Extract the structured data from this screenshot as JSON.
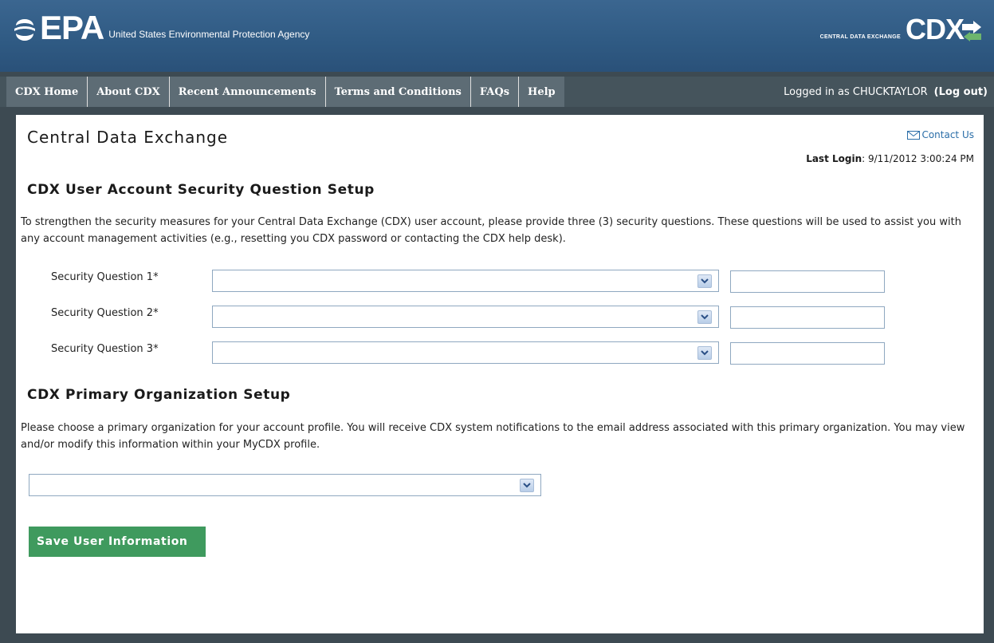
{
  "header": {
    "epa_logo_text": "EPA",
    "agency_name": "United States Environmental Protection Agency",
    "cdx_logo_subtext": "CENTRAL DATA EXCHANGE",
    "cdx_logo_text": "CDX"
  },
  "nav": {
    "items": [
      {
        "label": "CDX Home"
      },
      {
        "label": "About CDX"
      },
      {
        "label": "Recent Announcements"
      },
      {
        "label": "Terms and Conditions"
      },
      {
        "label": "FAQs"
      },
      {
        "label": "Help"
      }
    ],
    "logged_in_text": "Logged in as CHUCKTAYLOR",
    "logout_label": "(Log out)"
  },
  "main": {
    "title": "Central Data Exchange",
    "contact_label": "Contact Us",
    "last_login_label": "Last Login",
    "last_login_value": ": 9/11/2012 3:00:24 PM",
    "security": {
      "title": "CDX User Account Security Question Setup",
      "description": "To strengthen the security measures for your Central Data Exchange (CDX) user account, please provide three (3) security questions. These questions will be used to assist you with any account management activities (e.g., resetting you CDX password or contacting the CDX help desk).",
      "questions": [
        {
          "label": "Security Question 1*",
          "selected": "",
          "answer": ""
        },
        {
          "label": "Security Question 2*",
          "selected": "",
          "answer": ""
        },
        {
          "label": "Security Question 3*",
          "selected": "",
          "answer": ""
        }
      ]
    },
    "organization": {
      "title": "CDX Primary Organization Setup",
      "description": "Please choose a primary organization for your account profile. You will receive CDX system notifications to the email address associated with this primary organization. You may view and/or modify this information within your MyCDX profile.",
      "selected": ""
    },
    "save_label": "Save User Information"
  },
  "colors": {
    "header_blue": "#2f5a83",
    "nav_gray": "#5d6c75",
    "background": "#3d4a52",
    "link_blue": "#2b6ea8",
    "save_green": "#3f9a5e"
  }
}
